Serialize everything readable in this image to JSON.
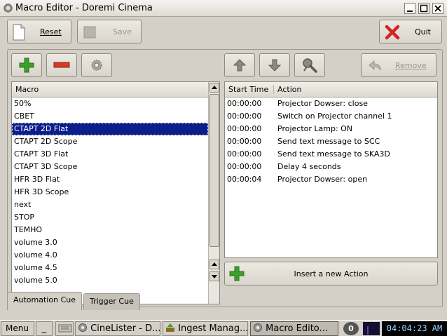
{
  "window": {
    "title": "Macro Editor - Doremi Cinema"
  },
  "toolbar": {
    "reset_label": "Reset",
    "save_label": "Save",
    "quit_label": "Quit",
    "remove_label": "Remove"
  },
  "macro_list": {
    "header": "Macro",
    "items": [
      "50%",
      "CBET",
      "CTAPT 2D Flat",
      "CTAPT 2D Scope",
      "CTAPT 3D Flat",
      "CTAPT 3D Scope",
      "HFR 3D Flat",
      "HFR 3D Scope",
      "next",
      "STOP",
      "TEMHO",
      "volume 3.0",
      "volume 4.0",
      "volume 4.5",
      "volume 5.0"
    ],
    "selected_index": 2
  },
  "action_list": {
    "headers": [
      "Start Time",
      "Action"
    ],
    "rows": [
      {
        "time": "00:00:00",
        "action": "Projector Dowser: close"
      },
      {
        "time": "00:00:00",
        "action": "Switch on Projector channel 1"
      },
      {
        "time": "00:00:00",
        "action": "Projector Lamp: ON"
      },
      {
        "time": "00:00:00",
        "action": "Send text message to SCC"
      },
      {
        "time": "00:00:00",
        "action": "Send text message to SKA3D"
      },
      {
        "time": "00:00:00",
        "action": "Delay 4 seconds"
      },
      {
        "time": "00:00:04",
        "action": "Projector Dowser: open"
      }
    ]
  },
  "insert_action_label": "Insert a new Action",
  "tabs": [
    "Automation Cue",
    "Trigger Cue"
  ],
  "taskbar": {
    "menu_label": "Menu",
    "minimize_label": "_",
    "tasks": [
      "CineLister - D...",
      "Ingest Manag...",
      "Macro Edito..."
    ],
    "badge": "0",
    "clock": "04:04:23 AM"
  },
  "colors": {
    "selection": "#0b1e8a",
    "add_green": "#3aa02b",
    "remove_red": "#d83a2a",
    "quit_red": "#d52323"
  }
}
